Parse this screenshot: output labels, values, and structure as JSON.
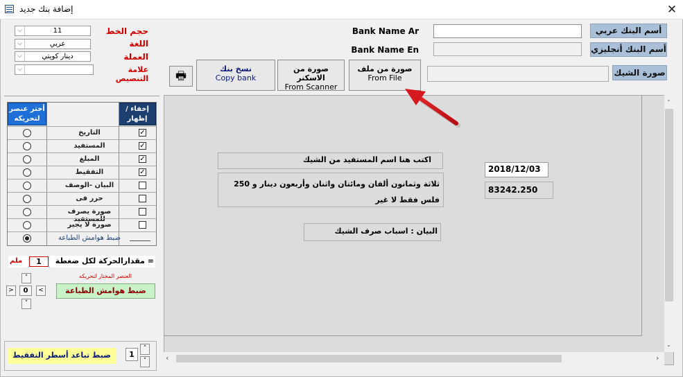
{
  "window": {
    "title": "إضافة بنك جديد",
    "close_glyph": "✕"
  },
  "settings": {
    "font_size_label": "حجم الخط",
    "font_size_value": "11",
    "language_label": "اللغة",
    "language_value": "عربي",
    "currency_label": "العملة",
    "currency_value": "دينار كويتي",
    "mark_label": "علامة التنصيص",
    "mark_value": ""
  },
  "bank": {
    "name_ar_label": "Bank Name Ar",
    "name_en_label": "Bank Name En",
    "name_ar_button": "أسم البنك عربي",
    "name_en_button": "أسم البنك أنجليزي",
    "name_ar_value": "",
    "name_en_value": "",
    "cheque_image_label": "صورة الشيك",
    "cheque_image_value": ""
  },
  "actions": {
    "from_file_ar": "صورة من ملف",
    "from_file_en": "From File",
    "from_scanner_ar": "صورة من الاسكنر",
    "from_scanner_en": "From Scanner",
    "copy_bank_ar": "نسخ بنك",
    "copy_bank_en": "Copy bank",
    "print_glyph": "🖶"
  },
  "cheque": {
    "payee_placeholder": "اكتب هنا اسم المستفيد من الشيك",
    "amount_words": "ثلاثة وثمانون ألفان ومائتان واثنان وأربعون دينار و 250 فلس فقط لا غير",
    "date_value": "2018/12/03",
    "amount_value": "83242.250",
    "memo": "البيان : اسباب صرف الشيك"
  },
  "elements_table": {
    "col_select_header": "أختر عنصر لتحريكه",
    "col_toggle_header": "إخفاء / إظهار",
    "rows": [
      {
        "label": "التاريخ",
        "shown": true,
        "selected": false
      },
      {
        "label": "المستفيد",
        "shown": true,
        "selected": false
      },
      {
        "label": "المبلغ",
        "shown": true,
        "selected": false
      },
      {
        "label": "التفقيط",
        "shown": true,
        "selected": false
      },
      {
        "label": "البيان -الوصف",
        "shown": false,
        "selected": false
      },
      {
        "label": "حرر فى",
        "shown": false,
        "selected": false
      },
      {
        "label": "صورة يصرف للمستفيد",
        "shown": false,
        "selected": false
      },
      {
        "label": "صورة لا يجير",
        "shown": false,
        "selected": false
      },
      {
        "label": "ضبط هوامش الطباعة",
        "shown": null,
        "selected": true
      }
    ]
  },
  "movement": {
    "step_label": "مقدارالحركة لكل ضغطة =",
    "step_value": "1",
    "step_unit": "ملم",
    "selected_element_label": "العنصر المختار لتحريكه",
    "selected_element_value": "ضبط هوامش الطباعة",
    "up": "˄",
    "down": "˅",
    "left": "<",
    "right": ">",
    "center_value": "0"
  },
  "line_spacing": {
    "label": "ضبط تباعد أسطر التفقيط",
    "value": "1"
  },
  "colors": {
    "accent_red": "#d40000",
    "header_blue": "#1f6fd8",
    "header_navy": "#1c3f70",
    "label_blue": "#a9c0d8"
  }
}
